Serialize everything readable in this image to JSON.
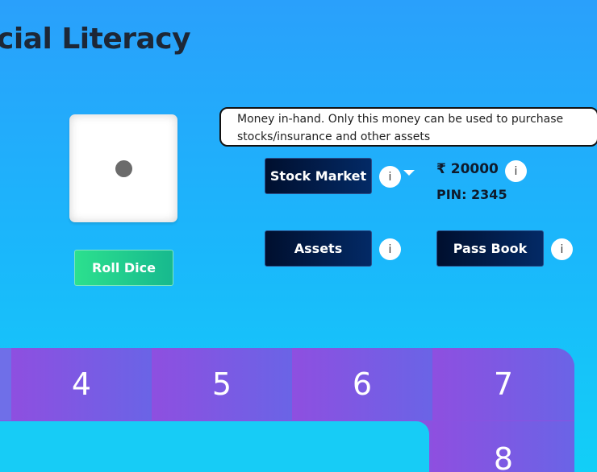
{
  "header": {
    "title": "cial Literacy"
  },
  "dice": {
    "value": 1,
    "roll_label": "Roll Dice"
  },
  "tooltip": {
    "text": "Money in-hand. Only this money can be used to purchase stocks/insurance and other assets"
  },
  "buttons": {
    "stock_market": "Stock Market",
    "assets": "Assets",
    "pass_book": "Pass Book"
  },
  "info_icon_glyph": "i",
  "wallet": {
    "money": "₹ 20000",
    "pin": "PIN: 2345"
  },
  "board": {
    "cells": [
      "4",
      "5",
      "6",
      "7",
      "8"
    ]
  },
  "colors": {
    "bg_top": "#2aa0fb",
    "bg_bottom": "#12cff7",
    "roll_button": "#2ce08e",
    "dark_button": "#000f2e",
    "board_purple": "#8a52e0"
  }
}
